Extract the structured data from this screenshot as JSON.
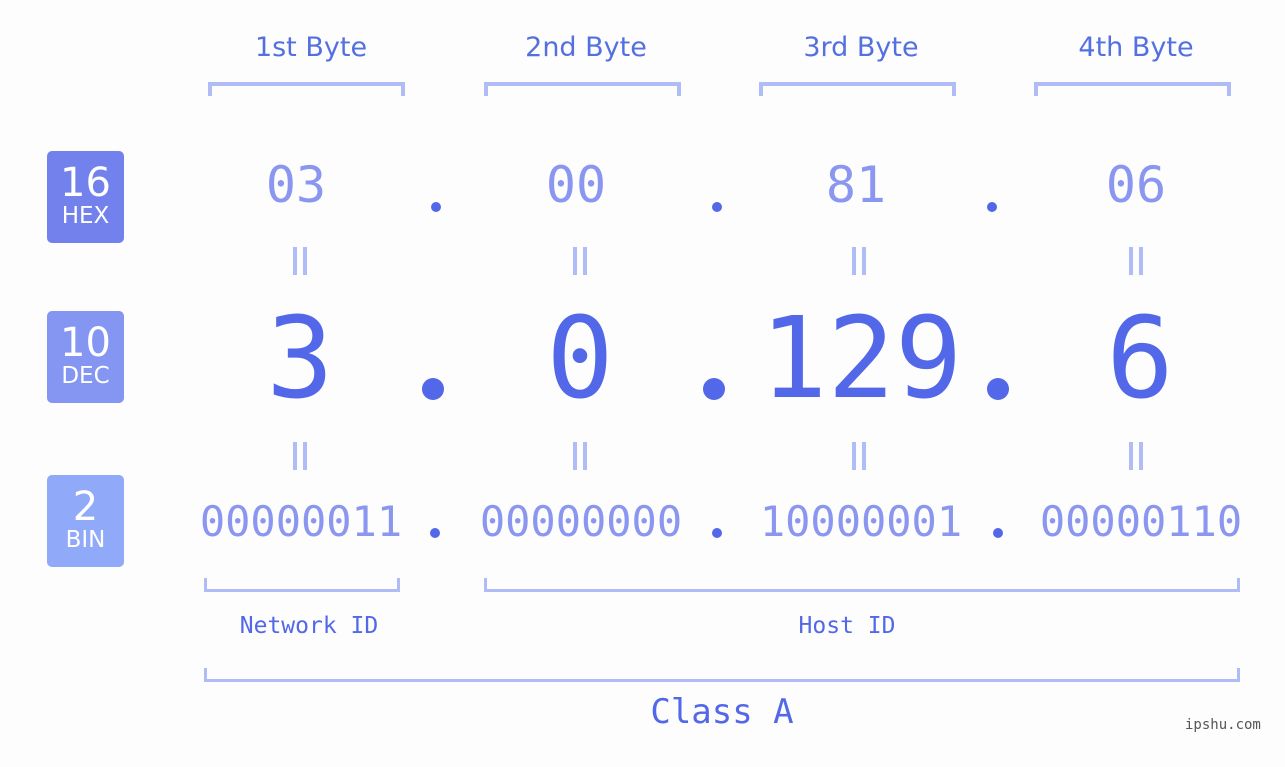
{
  "bytes": [
    {
      "title": "1st Byte",
      "hex": "03",
      "dec": "3",
      "bin": "00000011"
    },
    {
      "title": "2nd Byte",
      "hex": "00",
      "dec": "0",
      "bin": "00000000"
    },
    {
      "title": "3rd Byte",
      "hex": "81",
      "dec": "129",
      "bin": "10000001"
    },
    {
      "title": "4th Byte",
      "hex": "06",
      "dec": "6",
      "bin": "00000110"
    }
  ],
  "badges": {
    "hex": {
      "num": "16",
      "label": "HEX",
      "color": "#7281eb"
    },
    "dec": {
      "num": "10",
      "label": "DEC",
      "color": "#8595f2"
    },
    "bin": {
      "num": "2",
      "label": "BIN",
      "color": "#90a9f8"
    }
  },
  "segments": {
    "network": "Network ID",
    "host": "Host ID",
    "class": "Class A"
  },
  "watermark": "ipshu.com",
  "colors": {
    "accent": "#5268e8",
    "light": "#8a96ef",
    "bracket": "#b0bcf5",
    "background": "#fcfdfc"
  }
}
